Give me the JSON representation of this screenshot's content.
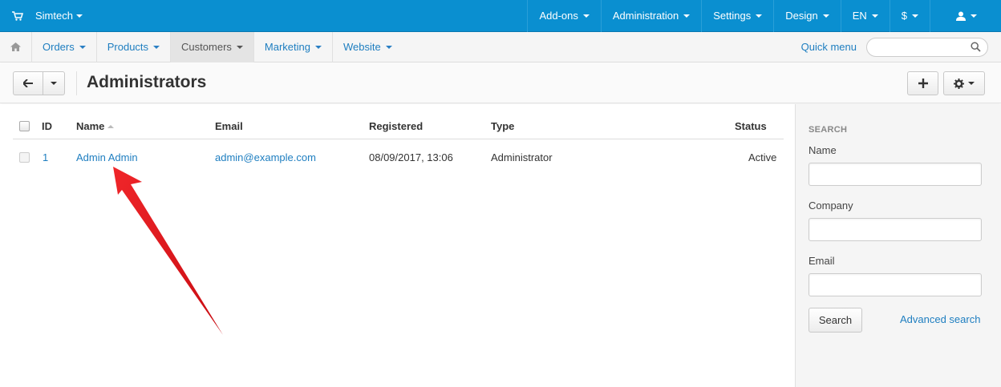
{
  "topbar": {
    "brand": "Simtech",
    "items": [
      {
        "label": "Add-ons"
      },
      {
        "label": "Administration"
      },
      {
        "label": "Settings"
      },
      {
        "label": "Design"
      },
      {
        "label": "EN"
      },
      {
        "label": "$"
      }
    ]
  },
  "subnav": {
    "items": [
      {
        "label": "Orders"
      },
      {
        "label": "Products"
      },
      {
        "label": "Customers"
      },
      {
        "label": "Marketing"
      },
      {
        "label": "Website"
      }
    ],
    "quick_menu": "Quick menu",
    "search_value": ""
  },
  "header": {
    "title": "Administrators"
  },
  "table": {
    "columns": {
      "id": "ID",
      "name": "Name",
      "email": "Email",
      "registered": "Registered",
      "type": "Type",
      "status": "Status"
    },
    "rows": [
      {
        "id": "1",
        "name": "Admin Admin",
        "email": "admin@example.com",
        "registered": "08/09/2017, 13:06",
        "type": "Administrator",
        "status": "Active"
      }
    ]
  },
  "sidebar": {
    "title": "SEARCH",
    "name_label": "Name",
    "name_value": "",
    "company_label": "Company",
    "company_value": "",
    "email_label": "Email",
    "email_value": "",
    "search_button": "Search",
    "advanced_search": "Advanced search"
  },
  "colors": {
    "topbar": "#0a8fd0",
    "link": "#1e7ec0",
    "annotation_arrow": "#e3141b"
  }
}
